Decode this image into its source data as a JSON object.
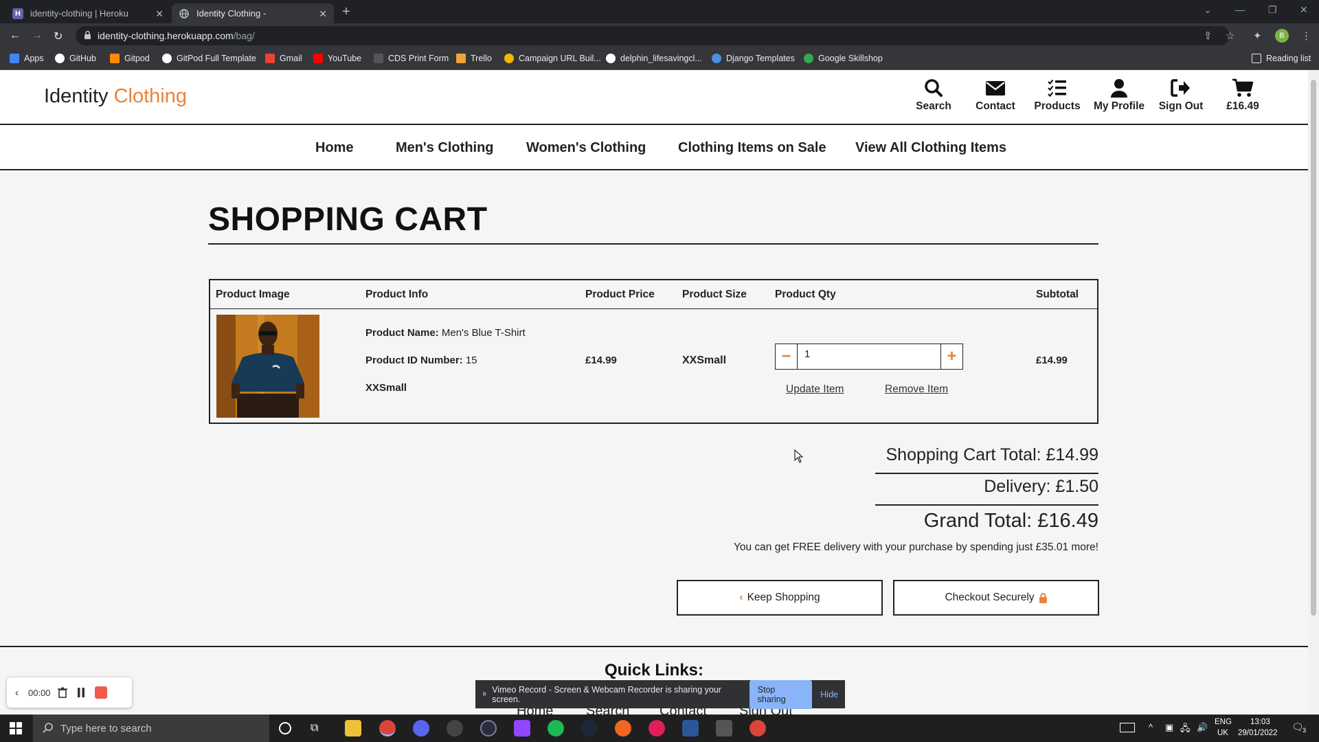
{
  "browser": {
    "tabs": [
      {
        "title": "identity-clothing | Heroku",
        "active": false,
        "favicon": "heroku-icon"
      },
      {
        "title": "Identity Clothing -",
        "active": true,
        "favicon": "globe-icon"
      }
    ],
    "url_domain": "identity-clothing.herokuapp.com",
    "url_path": "/bag/",
    "profile_initial": "B",
    "bookmarks": [
      {
        "label": "Apps",
        "icon": "apps-grid-icon",
        "color": "#4285f4"
      },
      {
        "label": "GitHub",
        "icon": "github-icon",
        "color": "#ffffff"
      },
      {
        "label": "Gitpod",
        "icon": "gitpod-icon",
        "color": "#ff8a00"
      },
      {
        "label": "GitPod Full Template",
        "icon": "github-icon",
        "color": "#ffffff"
      },
      {
        "label": "Gmail",
        "icon": "gmail-icon",
        "color": "#ea4335"
      },
      {
        "label": "YouTube",
        "icon": "youtube-icon",
        "color": "#ff0000"
      },
      {
        "label": "CDS Print Form",
        "icon": "cds-icon",
        "color": "#555555"
      },
      {
        "label": "Trello",
        "icon": "trello-icon",
        "color": "#f2a33a"
      },
      {
        "label": "Campaign URL Buil...",
        "icon": "campaign-icon",
        "color": "#f4b400"
      },
      {
        "label": "delphin_lifesavingcl...",
        "icon": "github-icon",
        "color": "#ffffff"
      },
      {
        "label": "Django Templates",
        "icon": "django-icon",
        "color": "#4a90e2"
      },
      {
        "label": "Google Skillshop",
        "icon": "google-icon",
        "color": "#34a853"
      }
    ],
    "reading_list": "Reading list"
  },
  "site": {
    "logo_main": "Identity",
    "logo_accent": "Clothing",
    "accent_color": "#e8833a",
    "header_icons": [
      {
        "label": "Search",
        "icon": "search-icon"
      },
      {
        "label": "Contact",
        "icon": "envelope-icon"
      },
      {
        "label": "Products",
        "icon": "list-icon"
      },
      {
        "label": "My Profile",
        "icon": "user-icon"
      },
      {
        "label": "Sign Out",
        "icon": "sign-out-icon"
      },
      {
        "label": "£16.49",
        "icon": "cart-icon"
      }
    ],
    "nav": [
      "Home",
      "Men's Clothing",
      "Women's Clothing",
      "Clothing Items on Sale",
      "View All Clothing Items"
    ],
    "page_title": "SHOPPING CART",
    "table_headers": [
      "Product Image",
      "Product Info",
      "Product Price",
      "Product Size",
      "Product Qty",
      "Subtotal"
    ],
    "item": {
      "name_label": "Product Name:",
      "name": "Men's Blue T-Shirt",
      "id_label": "Product ID Number:",
      "id": "15",
      "size_info": "XXSmall",
      "price": "£14.99",
      "size": "XXSmall",
      "qty": "1",
      "subtotal": "£14.99",
      "update": "Update Item",
      "remove": "Remove Item"
    },
    "totals": {
      "cart_total": "Shopping Cart Total: £14.99",
      "delivery": "Delivery: £1.50",
      "grand_total": "Grand Total: £16.49",
      "free_delivery_note": "You can get FREE delivery with your purchase by spending just £35.01 more!"
    },
    "buttons": {
      "keep_shopping": "Keep Shopping",
      "checkout": "Checkout Securely"
    },
    "quick_links_title": "Quick Links:",
    "footer_links": [
      "Home",
      "Search",
      "Contact",
      "Sign Out"
    ]
  },
  "overlays": {
    "recorder_time": "00:00",
    "share_text": "Vimeo Record - Screen & Webcam Recorder is sharing your screen.",
    "stop_sharing": "Stop sharing",
    "hide": "Hide"
  },
  "taskbar": {
    "search_placeholder": "Type here to search",
    "lang": "ENG",
    "region": "UK",
    "time": "13:03",
    "date": "29/01/2022",
    "notifications": "3"
  }
}
